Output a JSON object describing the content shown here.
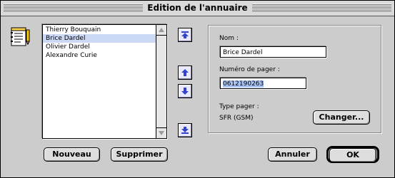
{
  "window": {
    "title": "Edition de l'annuaire"
  },
  "icons": {
    "app": "address-book-icon",
    "scroll_up": "scroll-up-arrow-icon",
    "scroll_down": "scroll-down-arrow-icon",
    "move_top": "move-to-top-icon",
    "move_up": "move-up-icon",
    "move_down": "move-down-icon",
    "move_bottom": "move-to-bottom-icon"
  },
  "list": {
    "items": [
      {
        "label": "Thierry Bouquain",
        "selected": false
      },
      {
        "label": "Brice Dardel",
        "selected": true
      },
      {
        "label": "Olivier Dardel",
        "selected": false
      },
      {
        "label": "Alexandre Curie",
        "selected": false
      }
    ]
  },
  "form": {
    "name_label": "Nom :",
    "name_value": "Brice Dardel",
    "pager_label": "Numéro de pager :",
    "pager_value": "0612190263",
    "type_label": "Type pager :",
    "type_value": "SFR (GSM)",
    "change_label": "Changer..."
  },
  "buttons": {
    "new_label": "Nouveau",
    "delete_label": "Supprimer",
    "cancel_label": "Annuler",
    "ok_label": "OK"
  },
  "colors": {
    "window_bg": "#cccccc",
    "selection": "#ccd9f5",
    "text_highlight": "#a9c3f2",
    "arrow_blue": "#3344cc"
  }
}
